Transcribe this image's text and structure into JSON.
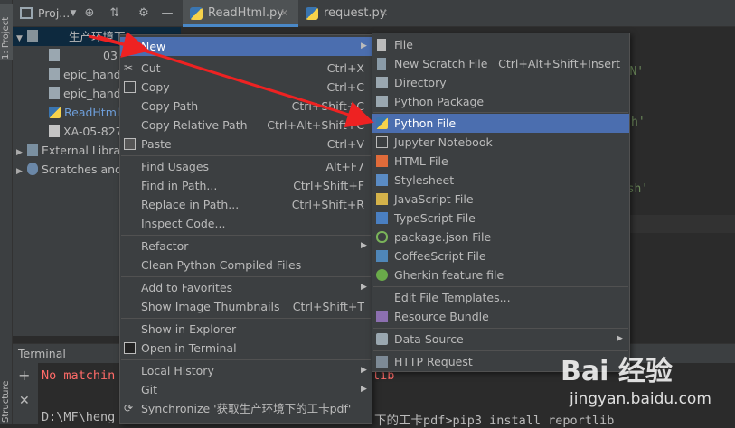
{
  "left_stripe": {
    "project_tab": "1: Project",
    "structure_tab": "Structure"
  },
  "tool_window": {
    "title": "Proj..."
  },
  "editor_tabs": [
    {
      "label": "ReadHtml.py"
    },
    {
      "label": "request.py"
    }
  ],
  "tree": {
    "root": "生产环境下",
    "items": [
      "03",
      "epic_handl",
      "epic_handl",
      "ReadHtml.",
      "XA-05-827"
    ],
    "external": "External Libra",
    "scratches": "Scratches and"
  },
  "editor": {
    "line1": "h\\EN'",
    "line2": "h'",
    "line3": "lish'"
  },
  "terminal": {
    "title": "Terminal",
    "error_text": "No matchin",
    "error_tail": "lib",
    "prompt_text": "D:\\MF\\heng",
    "command_tail": "下的工卡pdf>pip3 install reportlib"
  },
  "context_menu": {
    "items": [
      {
        "label": "New",
        "shortcut": "",
        "submenu": true,
        "selected": true
      },
      {
        "label": "Cut",
        "shortcut": "Ctrl+X"
      },
      {
        "label": "Copy",
        "shortcut": "Ctrl+C"
      },
      {
        "label": "Copy Path",
        "shortcut": "Ctrl+Shift+C"
      },
      {
        "label": "Copy Relative Path",
        "shortcut": "Ctrl+Alt+Shift+C"
      },
      {
        "label": "Paste",
        "shortcut": "Ctrl+V"
      },
      {
        "label": "Find Usages",
        "shortcut": "Alt+F7"
      },
      {
        "label": "Find in Path...",
        "shortcut": "Ctrl+Shift+F"
      },
      {
        "label": "Replace in Path...",
        "shortcut": "Ctrl+Shift+R"
      },
      {
        "label": "Inspect Code...",
        "shortcut": ""
      },
      {
        "label": "Refactor",
        "shortcut": "",
        "submenu": true
      },
      {
        "label": "Clean Python Compiled Files",
        "shortcut": ""
      },
      {
        "label": "Add to Favorites",
        "shortcut": "",
        "submenu": true
      },
      {
        "label": "Show Image Thumbnails",
        "shortcut": "Ctrl+Shift+T"
      },
      {
        "label": "Show in Explorer",
        "shortcut": ""
      },
      {
        "label": "Open in Terminal",
        "shortcut": ""
      },
      {
        "label": "Local History",
        "shortcut": "",
        "submenu": true
      },
      {
        "label": "Git",
        "shortcut": "",
        "submenu": true
      },
      {
        "label": "Synchronize '获取生产环境下的工卡pdf'",
        "shortcut": ""
      }
    ]
  },
  "new_submenu": {
    "items": [
      {
        "label": "File",
        "shortcut": ""
      },
      {
        "label": "New Scratch File",
        "shortcut": "Ctrl+Alt+Shift+Insert"
      },
      {
        "label": "Directory",
        "shortcut": ""
      },
      {
        "label": "Python Package",
        "shortcut": ""
      },
      {
        "label": "Python File",
        "shortcut": "",
        "selected": true
      },
      {
        "label": "Jupyter Notebook",
        "shortcut": ""
      },
      {
        "label": "HTML File",
        "shortcut": ""
      },
      {
        "label": "Stylesheet",
        "shortcut": ""
      },
      {
        "label": "JavaScript File",
        "shortcut": ""
      },
      {
        "label": "TypeScript File",
        "shortcut": ""
      },
      {
        "label": "package.json File",
        "shortcut": ""
      },
      {
        "label": "CoffeeScript File",
        "shortcut": ""
      },
      {
        "label": "Gherkin feature file",
        "shortcut": ""
      },
      {
        "label": "Edit File Templates...",
        "shortcut": ""
      },
      {
        "label": "Resource Bundle",
        "shortcut": ""
      },
      {
        "label": "Data Source",
        "shortcut": "",
        "submenu": true
      },
      {
        "label": "HTTP Request",
        "shortcut": ""
      }
    ]
  },
  "watermark": {
    "logo": "Bai 经验",
    "url": "jingyan.baidu.com"
  },
  "colors": {
    "selection": "#4b6eaf",
    "menu_bg": "#3c3f41",
    "error": "#ff6b68",
    "arrow": "#ee2222"
  }
}
